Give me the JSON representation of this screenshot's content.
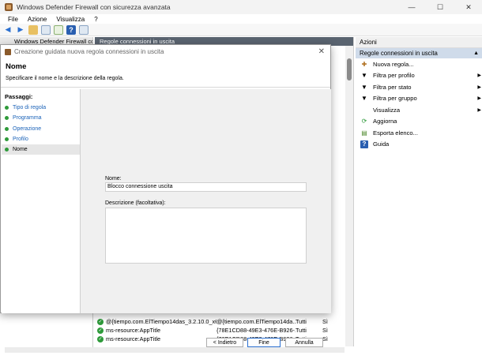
{
  "window": {
    "title": "Windows Defender Firewall con sicurezza avanzata",
    "minimize": "—",
    "maximize": "☐",
    "close": "✕"
  },
  "menu": [
    "File",
    "Azione",
    "Visualizza",
    "?"
  ],
  "left_panel": {
    "header": "Windows Defender Firewall con..."
  },
  "center_panel": {
    "header": "Regole connessioni in uscita",
    "rows": [
      {
        "name": "@{tiempo.com.ElTiempo14das_3.2.10.0_x64...",
        "group": "@{tiempo.com.ElTiempo14da...",
        "profile": "Tutti",
        "enabled": "Sì"
      },
      {
        "name": "ms-resource:AppTitle",
        "group": "{78E1CD88-49E3-476E-B926-...",
        "profile": "Tutti",
        "enabled": "Sì"
      },
      {
        "name": "ms-resource:AppTitle",
        "group": "{78E1CD88-49E3-476E-B926-...",
        "profile": "Tutti",
        "enabled": "Sì"
      }
    ]
  },
  "actions_panel": {
    "header": "Azioni",
    "section": "Regole connessioni in uscita",
    "items": [
      {
        "label": "Nuova regola...",
        "icon": "new-rule-icon",
        "submenu": false
      },
      {
        "label": "Filtra per profilo",
        "icon": "filter-icon",
        "submenu": true
      },
      {
        "label": "Filtra per stato",
        "icon": "filter-icon",
        "submenu": true
      },
      {
        "label": "Filtra per gruppo",
        "icon": "filter-icon",
        "submenu": true
      },
      {
        "label": "Visualizza",
        "icon": "view-icon",
        "submenu": true
      },
      {
        "label": "Aggiorna",
        "icon": "refresh-icon",
        "submenu": false
      },
      {
        "label": "Esporta elenco...",
        "icon": "export-icon",
        "submenu": false
      },
      {
        "label": "Guida",
        "icon": "help-icon",
        "submenu": false
      }
    ]
  },
  "wizard": {
    "title": "Creazione guidata nuova regola connessioni in uscita",
    "heading": "Nome",
    "subtitle": "Specificare il nome e la descrizione della regola.",
    "steps_label": "Passaggi:",
    "steps": [
      "Tipo di regola",
      "Programma",
      "Operazione",
      "Profilo",
      "Nome"
    ],
    "name_label": "Nome:",
    "name_value": "Blocco connessione uscita",
    "description_label": "Descrizione (facoltativa):",
    "description_value": "",
    "back_button": "< Indietro",
    "finish_button": "Fine",
    "cancel_button": "Annulla",
    "close": "✕"
  },
  "colors": {
    "accent_blue": "#1a62b8",
    "step_done_green": "#2e9a3a",
    "actions_section": "#cfdbea"
  }
}
